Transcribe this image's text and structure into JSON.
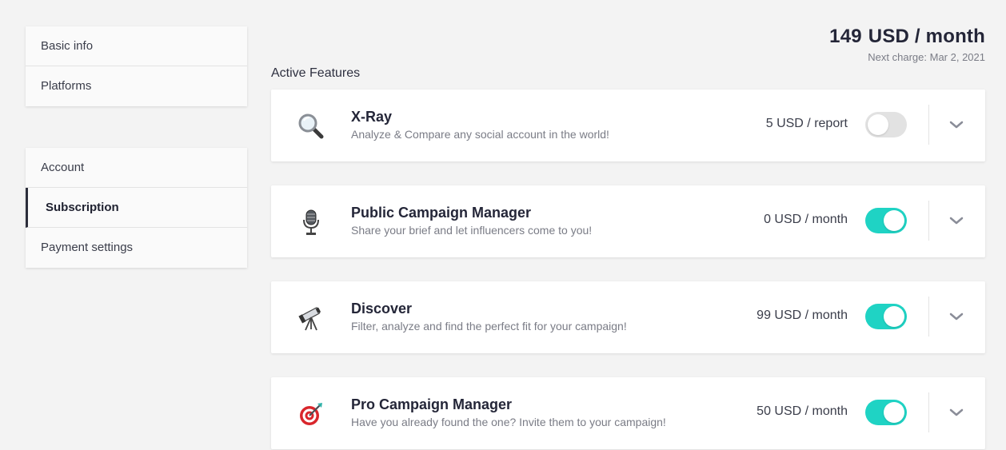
{
  "sidebar": {
    "top_items": [
      {
        "label": "Basic info"
      },
      {
        "label": "Platforms"
      }
    ],
    "bottom_items": [
      {
        "label": "Account"
      },
      {
        "label": "Subscription",
        "active": true
      },
      {
        "label": "Payment settings"
      }
    ]
  },
  "summary": {
    "amount": "149",
    "unit": "USD / month",
    "next_charge": "Next charge: Mar 2, 2021"
  },
  "section_title": "Active Features",
  "features": [
    {
      "icon": "magnifier-icon",
      "name": "X-Ray",
      "description": "Analyze & Compare any social account in the world!",
      "price": "5 USD / report",
      "enabled": false
    },
    {
      "icon": "microphone-icon",
      "name": "Public Campaign Manager",
      "description": "Share your brief and let influencers come to you!",
      "price": "0 USD / month",
      "enabled": true
    },
    {
      "icon": "telescope-icon",
      "name": "Discover",
      "description": "Filter, analyze and find the perfect fit for your campaign!",
      "price": "99 USD / month",
      "enabled": true
    },
    {
      "icon": "target-icon",
      "name": "Pro Campaign Manager",
      "description": "Have you already found the one? Invite them to your campaign!",
      "price": "50 USD / month",
      "enabled": true
    }
  ],
  "colors": {
    "toggle_on": "#1fd3c4",
    "toggle_off": "#e2e2e2",
    "text_dark": "#242638",
    "text_muted": "#7a7c86"
  }
}
